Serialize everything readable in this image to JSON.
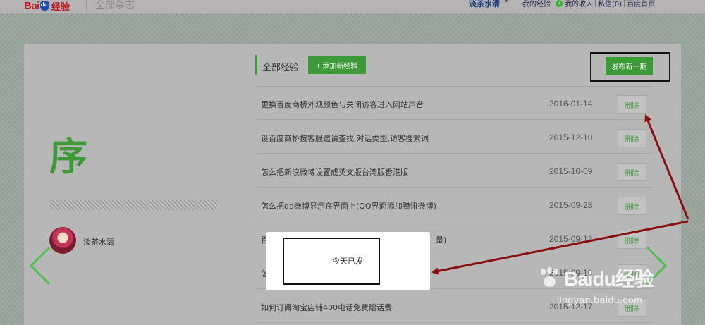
{
  "header": {
    "logo": "Baidu经验",
    "site_title": "全部杂志",
    "user_name": "淡茶水清",
    "nav": {
      "my_experience": "我的经验",
      "my_income": "我的收入",
      "messages": "私信(0)",
      "baidu_home": "百度首页"
    }
  },
  "sidebar": {
    "preface": "序",
    "author": "淡茶水清"
  },
  "main": {
    "section_title": "全部经验",
    "add_button": "+ 添加新经验",
    "publish_button": "发布新一期",
    "delete_label": "删除",
    "rows": [
      {
        "title": "更换百度商桥外观颜色与关闭访客进入网站声音",
        "date": "2016-01-14"
      },
      {
        "title": "设百度商桥按客服邀请查找,对话类型,访客搜索词",
        "date": "2015-12-10"
      },
      {
        "title": "怎么把新浪微博设置成英文版台湾版香港版",
        "date": "2015-10-09"
      },
      {
        "title": "怎么把qq微博显示在界面上(QQ界面添加腾讯微博)",
        "date": "2015-09-28"
      },
      {
        "title": "百",
        "title_tail": "量)",
        "date": "2015-09-12"
      },
      {
        "title": "怎",
        "date": "2015-09-10"
      },
      {
        "title": "如何订阅淘宝店铺400电话免费赠话费",
        "date": "2015-12-17"
      }
    ]
  },
  "popup": {
    "message": "今天已发"
  },
  "watermark": {
    "brand": "Baidu经验",
    "url": "jingyan.baidu.com"
  },
  "colors": {
    "accent_green": "#3e9a38",
    "arrow_red": "#8a1010",
    "logo_red": "#c0181f"
  }
}
